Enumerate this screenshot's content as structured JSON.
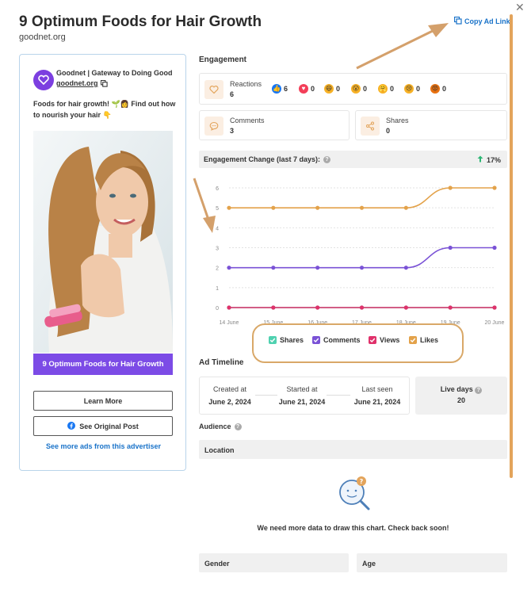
{
  "header": {
    "title": "9 Optimum Foods for Hair Growth",
    "domain": "goodnet.org",
    "copy_link_label": "Copy Ad Link",
    "close_glyph": "✕"
  },
  "ad": {
    "advertiser_name": "Goodnet | Gateway to Doing Good",
    "advertiser_domain": "goodnet.org",
    "text_line1": "Foods for hair growth! 🌱👩 Find out how",
    "text_line2": "to nourish your hair 👇",
    "banner_title": "9 Optimum Foods for Hair Growth",
    "learn_more_label": "Learn More",
    "original_post_label": "See Original Post",
    "more_ads_label": "See more ads from this advertiser",
    "brand_color": "#7c4be6"
  },
  "engagement": {
    "title": "Engagement",
    "reactions_label": "Reactions",
    "reactions_value": "6",
    "reactions": [
      {
        "icon": "like-icon",
        "count": "6"
      },
      {
        "icon": "love-icon",
        "count": "0"
      },
      {
        "icon": "haha-icon",
        "count": "0"
      },
      {
        "icon": "wow-icon",
        "count": "0"
      },
      {
        "icon": "care-icon",
        "count": "0"
      },
      {
        "icon": "sad-icon",
        "count": "0"
      },
      {
        "icon": "angry-icon",
        "count": "0"
      }
    ],
    "comments_label": "Comments",
    "comments_value": "3",
    "shares_label": "Shares",
    "shares_value": "0",
    "change_label": "Engagement Change (last 7 days):",
    "change_value": "17%"
  },
  "chart_data": {
    "type": "line",
    "x": [
      "14 June",
      "15 June",
      "16 June",
      "17 June",
      "18 June",
      "19 June",
      "20 June"
    ],
    "ylim": [
      0,
      6
    ],
    "yticks": [
      "0",
      "1",
      "2",
      "3",
      "4",
      "5",
      "6"
    ],
    "grid": true,
    "series": [
      {
        "name": "Shares",
        "color": "#4fd1b0",
        "values": [
          0,
          0,
          0,
          0,
          0,
          0,
          0
        ]
      },
      {
        "name": "Comments",
        "color": "#7a52d6",
        "values": [
          2,
          2,
          2,
          2,
          2,
          3,
          3
        ]
      },
      {
        "name": "Views",
        "color": "#e0316b",
        "values": [
          0,
          0,
          0,
          0,
          0,
          0,
          0
        ]
      },
      {
        "name": "Likes",
        "color": "#e3a24a",
        "values": [
          5,
          5,
          5,
          5,
          5,
          6,
          6
        ]
      }
    ]
  },
  "legend": [
    {
      "label": "Shares",
      "color": "#4fd1b0"
    },
    {
      "label": "Comments",
      "color": "#7a52d6"
    },
    {
      "label": "Views",
      "color": "#e0316b"
    },
    {
      "label": "Likes",
      "color": "#e3a24a"
    }
  ],
  "timeline": {
    "title": "Ad Timeline",
    "created_label": "Created at",
    "created_value": "June 2, 2024",
    "started_label": "Started at",
    "started_value": "June 21, 2024",
    "last_seen_label": "Last seen",
    "last_seen_value": "June 21, 2024",
    "live_days_label": "Live days",
    "live_days_value": "20"
  },
  "audience": {
    "title": "Audience",
    "location_label": "Location",
    "no_data_message": "We need more data to draw this chart. Check back soon!",
    "gender_label": "Gender",
    "age_label": "Age"
  },
  "colors": {
    "accent": "#1a73c9",
    "annotation": "#d9a868",
    "panel_bg": "#f0f0f0"
  }
}
